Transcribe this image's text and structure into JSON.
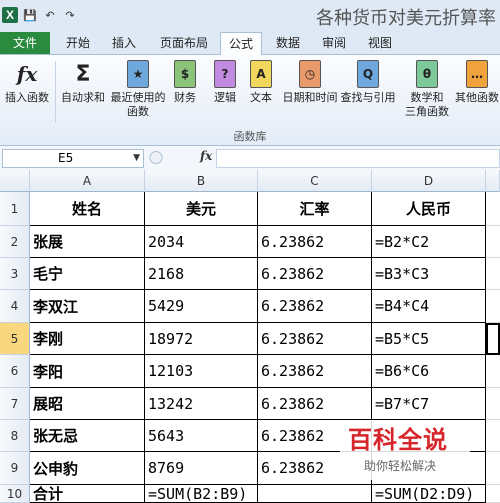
{
  "window": {
    "title": "各种货币对美元折算率"
  },
  "quick_access": {
    "excel": "X",
    "save": "💾",
    "undo": "↶",
    "redo": "↷"
  },
  "tabs": [
    "文件",
    "开始",
    "插入",
    "页面布局",
    "公式",
    "数据",
    "审阅",
    "视图"
  ],
  "ribbon": {
    "buttons": [
      {
        "label": "插入函数",
        "icon": "fx"
      },
      {
        "label": "自动求和",
        "icon": "Σ",
        "dropdown": "▾"
      },
      {
        "label": "最近使用的\n函数",
        "icon": "★"
      },
      {
        "label": "财务",
        "icon": "$"
      },
      {
        "label": "逻辑",
        "icon": "?"
      },
      {
        "label": "文本",
        "icon": "A"
      },
      {
        "label": "日期和时间",
        "icon": "◷"
      },
      {
        "label": "查找与引用",
        "icon": "Q"
      },
      {
        "label": "数学和\n三角函数",
        "icon": "θ"
      },
      {
        "label": "其他函数",
        "icon": "…"
      }
    ],
    "group_label": "函数库"
  },
  "formula_bar": {
    "name_box": "E5",
    "fx": "fx",
    "formula": ""
  },
  "columns": [
    "A",
    "B",
    "C",
    "D"
  ],
  "rows": [
    {
      "num": "1",
      "cells": [
        "姓名",
        "美元",
        "汇率",
        "人民币"
      ]
    },
    {
      "num": "2",
      "cells": [
        "张展",
        "2034",
        "6.23862",
        "=B2*C2"
      ]
    },
    {
      "num": "3",
      "cells": [
        "毛宁",
        "2168",
        "6.23862",
        "=B3*C3"
      ]
    },
    {
      "num": "4",
      "cells": [
        "李双江",
        "5429",
        "6.23862",
        "=B4*C4"
      ]
    },
    {
      "num": "5",
      "cells": [
        "李刚",
        "18972",
        "6.23862",
        "=B5*C5"
      ]
    },
    {
      "num": "6",
      "cells": [
        "李阳",
        "12103",
        "6.23862",
        "=B6*C6"
      ]
    },
    {
      "num": "7",
      "cells": [
        "展昭",
        "13242",
        "6.23862",
        "=B7*C7"
      ]
    },
    {
      "num": "8",
      "cells": [
        "张无忌",
        "5643",
        "6.23862",
        ""
      ]
    },
    {
      "num": "9",
      "cells": [
        "公申豹",
        "8769",
        "6.23862",
        ""
      ]
    },
    {
      "num": "10",
      "cells": [
        "合计",
        "=SUM(B2:B9)",
        "",
        "=SUM(D2:D9)"
      ]
    }
  ],
  "watermark": {
    "title": "百科全说",
    "subtitle": "助你轻松解决"
  }
}
